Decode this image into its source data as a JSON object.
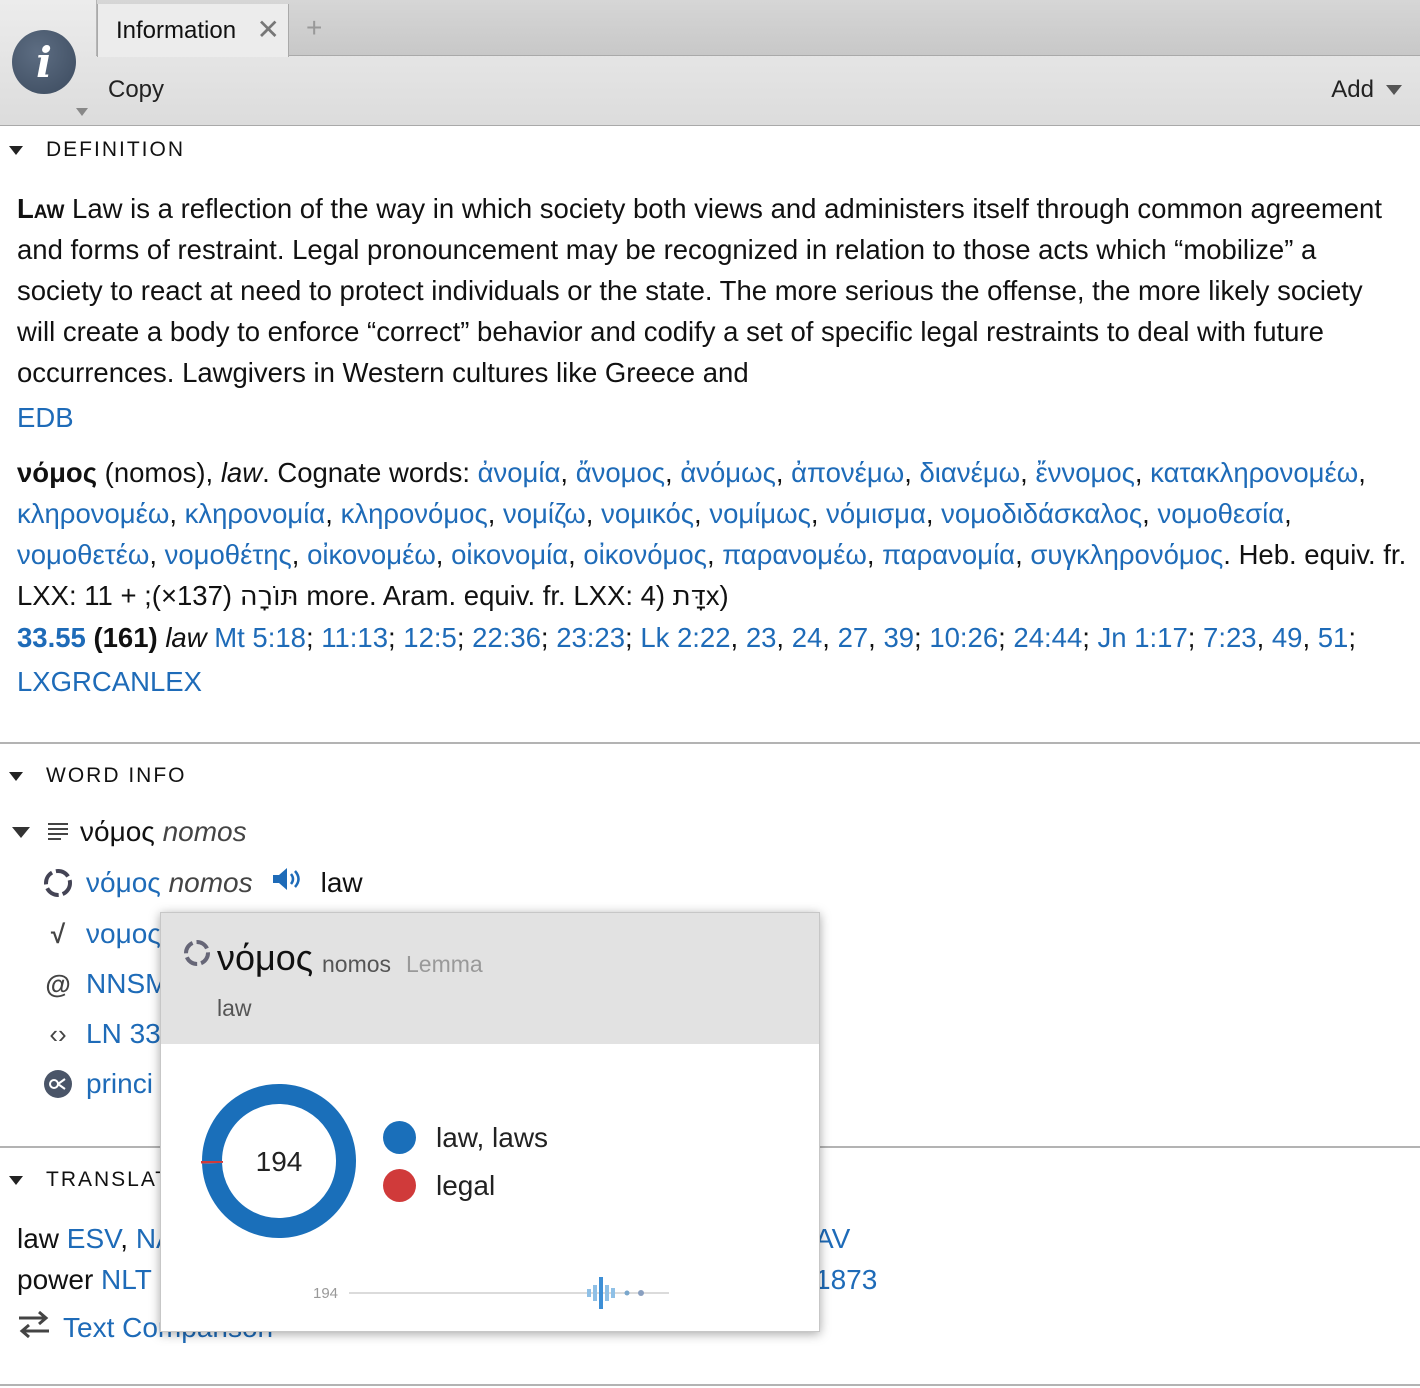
{
  "header": {
    "tab_label": "Information",
    "copy_label": "Copy",
    "add_label": "Add"
  },
  "definition": {
    "heading": "DEFINITION",
    "headword": "Law",
    "text": "Law is a reflection of the way in which society both views and administers itself through common agreement and forms of restraint. Legal pronouncement may be recognized in relation to those acts which “mobilize” a society to react at need to protect individuals or the state. The more serious the offense, the more likely society will create a body to enforce “correct” behavior and codify a set of specific legal restraints to deal with future occurrences. Lawgivers in Western cultures like Greece and",
    "source": "EDB",
    "lexicon": {
      "lemma": "νόμος",
      "translit": "(nomos),",
      "gloss": "law",
      "cognate_label": ". Cognate words:",
      "cognates": [
        "ἀνομία",
        "ἄνομος",
        "ἀνόμως",
        "ἀπονέμω",
        "διανέμω",
        "ἔννομος",
        "κατακληρονομέω",
        "κληρονομέω",
        "κληρονομία",
        "κληρονόμος",
        "νομίζω",
        "νομικός",
        "νομίμως",
        "νόμισμα",
        "νομοδιδάσκαλος",
        "νομοθεσία",
        "νομοθετέω",
        "νομοθέτης",
        "οἰκονομέω",
        "οἰκονομία",
        "οἰκονόμος",
        "παρανομέω",
        "παρανομία",
        "συγκληρονόμος"
      ],
      "heb_text": ". Heb. equiv. fr. LXX: 11 + ;(×137)",
      "heb_word": "תּוֹרָה",
      "aram_text": "more. Aram. equiv. fr. LXX: 4)",
      "aram_word": "דָּת",
      "aram_tail": "x)",
      "entry_number": "33.55",
      "entry_count": "(161)",
      "entry_gloss": "law",
      "refs": [
        "Mt 5:18",
        "11:13",
        "12:5",
        "22:36",
        "23:23",
        "Lk 2:22",
        "23",
        "24",
        "27",
        "39",
        "10:26",
        "24:44",
        "Jn 1:17",
        "7:23",
        "49",
        "51"
      ],
      "source": "LXGRCANLEX"
    }
  },
  "word_info": {
    "heading": "WORD INFO",
    "surface": "νόμος",
    "surface_translit": "nomos",
    "lemma": "νόμος",
    "lemma_translit": "nomos",
    "lemma_gloss": "law",
    "root": "νομος",
    "morph": "NNSM",
    "domain": "LN 33",
    "sense": "princi"
  },
  "translation": {
    "heading": "TRANSLAT",
    "row1_word": "law",
    "row1_sources": [
      "ESV",
      "NA"
    ],
    "row1_tail": "AV 1873",
    "row2_word": "power",
    "row2_source": "NLT",
    "compare_label": "Text Comparison"
  },
  "popup": {
    "lemma": "νόμος",
    "translit": "nomos",
    "kind": "Lemma",
    "gloss": "law",
    "total": "194",
    "legend": [
      {
        "label": "law, laws",
        "color": "#1a6fba"
      },
      {
        "label": "legal",
        "color": "#d03a3a"
      }
    ],
    "frequency_label": "194"
  },
  "chart_data": {
    "type": "pie",
    "title": "",
    "center_label": "194",
    "categories": [
      "law, laws",
      "legal"
    ],
    "values": [
      193,
      1
    ],
    "colors": [
      "#1a6fba",
      "#d03a3a"
    ]
  }
}
